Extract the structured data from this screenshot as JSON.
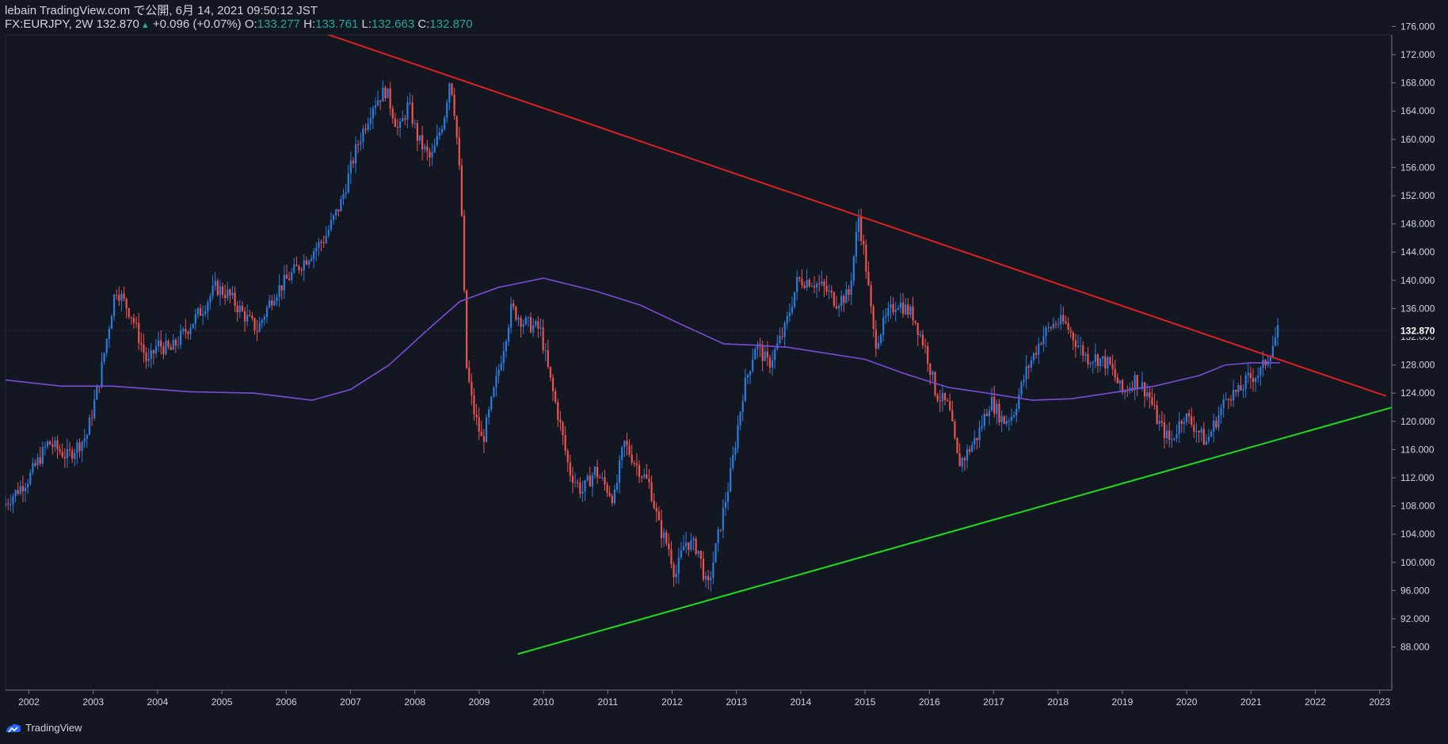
{
  "header": {
    "publish_line": "lebain TradingView.com で公開, 6月 14, 2021 09:50:12 JST",
    "symbol": "FX:EURJPY, 2W",
    "last": "132.870",
    "change_arrow": "▲",
    "change": "+0.096 (+0.07%)",
    "o_label": "O:",
    "o_value": "133.277",
    "h_label": "H:",
    "h_value": "133.761",
    "l_label": "L:",
    "l_value": "132.663",
    "c_label": "C:",
    "c_value": "132.870"
  },
  "footer": {
    "brand": "TradingView"
  },
  "colors": {
    "background": "#131722",
    "up_candle": "#2a7ddf",
    "down_candle": "#ef5350",
    "resistance_line": "#e21f1f",
    "support_line": "#1fdc1f",
    "moving_average": "#7b4bd8",
    "text": "#d1d4dc",
    "accent_green": "#26a69a"
  },
  "chart_data": {
    "type": "candlestick",
    "symbol": "FX:EURJPY",
    "interval": "2W",
    "ylim": [
      86,
      179
    ],
    "y_ticks": [
      "176.000",
      "172.000",
      "168.000",
      "164.000",
      "160.000",
      "156.000",
      "152.000",
      "148.000",
      "144.000",
      "140.000",
      "136.000",
      "132.000",
      "128.000",
      "124.000",
      "120.000",
      "116.000",
      "112.000",
      "108.000",
      "104.000",
      "100.000",
      "96.000",
      "92.000",
      "88.000"
    ],
    "x_ticks": [
      "2002",
      "2003",
      "2004",
      "2005",
      "2006",
      "2007",
      "2008",
      "2009",
      "2010",
      "2011",
      "2012",
      "2013",
      "2014",
      "2015",
      "2016",
      "2017",
      "2018",
      "2019",
      "2020",
      "2021",
      "2022",
      "2023"
    ],
    "last_price_label": "132.870",
    "price_path": [
      [
        2001.6,
        108
      ],
      [
        2002.0,
        112
      ],
      [
        2002.3,
        117
      ],
      [
        2002.6,
        115
      ],
      [
        2002.9,
        118
      ],
      [
        2003.1,
        126
      ],
      [
        2003.35,
        139
      ],
      [
        2003.6,
        135
      ],
      [
        2003.85,
        128
      ],
      [
        2004.0,
        131
      ],
      [
        2004.2,
        130
      ],
      [
        2004.45,
        133
      ],
      [
        2004.7,
        136
      ],
      [
        2004.9,
        139
      ],
      [
        2005.1,
        138
      ],
      [
        2005.35,
        135
      ],
      [
        2005.55,
        133
      ],
      [
        2005.8,
        138
      ],
      [
        2006.0,
        140
      ],
      [
        2006.3,
        143
      ],
      [
        2006.6,
        146
      ],
      [
        2006.85,
        151
      ],
      [
        2007.1,
        159
      ],
      [
        2007.35,
        165
      ],
      [
        2007.55,
        167
      ],
      [
        2007.75,
        161
      ],
      [
        2007.9,
        165
      ],
      [
        2008.05,
        160
      ],
      [
        2008.25,
        157
      ],
      [
        2008.45,
        163
      ],
      [
        2008.55,
        169
      ],
      [
        2008.63,
        163
      ],
      [
        2008.72,
        152
      ],
      [
        2008.8,
        128
      ],
      [
        2008.9,
        122
      ],
      [
        2009.05,
        117
      ],
      [
        2009.25,
        125
      ],
      [
        2009.5,
        136
      ],
      [
        2009.7,
        134
      ],
      [
        2009.95,
        133
      ],
      [
        2010.1,
        126
      ],
      [
        2010.25,
        120
      ],
      [
        2010.4,
        113
      ],
      [
        2010.6,
        110
      ],
      [
        2010.8,
        113
      ],
      [
        2010.95,
        111
      ],
      [
        2011.1,
        109
      ],
      [
        2011.25,
        117
      ],
      [
        2011.5,
        113
      ],
      [
        2011.65,
        111
      ],
      [
        2011.8,
        105
      ],
      [
        2011.95,
        102
      ],
      [
        2012.05,
        98
      ],
      [
        2012.2,
        103
      ],
      [
        2012.4,
        102
      ],
      [
        2012.55,
        96
      ],
      [
        2012.7,
        103
      ],
      [
        2012.9,
        112
      ],
      [
        2013.1,
        124
      ],
      [
        2013.3,
        131
      ],
      [
        2013.5,
        128
      ],
      [
        2013.75,
        133
      ],
      [
        2013.95,
        140
      ],
      [
        2014.15,
        140
      ],
      [
        2014.35,
        139
      ],
      [
        2014.55,
        137
      ],
      [
        2014.75,
        138
      ],
      [
        2014.9,
        149
      ],
      [
        2015.0,
        143
      ],
      [
        2015.15,
        131
      ],
      [
        2015.35,
        135
      ],
      [
        2015.5,
        137
      ],
      [
        2015.75,
        135
      ],
      [
        2015.95,
        130
      ],
      [
        2016.1,
        124
      ],
      [
        2016.3,
        122
      ],
      [
        2016.45,
        114
      ],
      [
        2016.55,
        115
      ],
      [
        2016.75,
        118
      ],
      [
        2016.95,
        123
      ],
      [
        2017.15,
        120
      ],
      [
        2017.3,
        121
      ],
      [
        2017.5,
        127
      ],
      [
        2017.75,
        132
      ],
      [
        2017.95,
        134
      ],
      [
        2018.1,
        134
      ],
      [
        2018.3,
        131
      ],
      [
        2018.45,
        129
      ],
      [
        2018.6,
        129
      ],
      [
        2018.8,
        128
      ],
      [
        2019.0,
        124
      ],
      [
        2019.2,
        126
      ],
      [
        2019.4,
        124
      ],
      [
        2019.55,
        120
      ],
      [
        2019.75,
        117
      ],
      [
        2019.95,
        121
      ],
      [
        2020.15,
        119
      ],
      [
        2020.3,
        117
      ],
      [
        2020.5,
        121
      ],
      [
        2020.65,
        124
      ],
      [
        2020.8,
        124
      ],
      [
        2020.95,
        126
      ],
      [
        2021.15,
        127
      ],
      [
        2021.3,
        130
      ],
      [
        2021.45,
        133.5
      ]
    ],
    "series": [
      {
        "name": "",
        "type": "moving_average",
        "points": [
          [
            2001.5,
            126
          ],
          [
            2002.5,
            125
          ],
          [
            2003.3,
            125
          ],
          [
            2004.5,
            124.2
          ],
          [
            2005.5,
            124
          ],
          [
            2006.4,
            123
          ],
          [
            2007.0,
            124.5
          ],
          [
            2007.6,
            128
          ],
          [
            2008.2,
            133
          ],
          [
            2008.7,
            137
          ],
          [
            2009.3,
            139
          ],
          [
            2010.0,
            140.3
          ],
          [
            2010.8,
            138.5
          ],
          [
            2011.5,
            136.5
          ],
          [
            2012.2,
            133.5
          ],
          [
            2012.8,
            131
          ],
          [
            2013.3,
            130.8
          ],
          [
            2013.8,
            130.5
          ],
          [
            2014.5,
            129.5
          ],
          [
            2015.0,
            128.8
          ],
          [
            2015.6,
            126.8
          ],
          [
            2016.3,
            124.8
          ],
          [
            2016.9,
            124
          ],
          [
            2017.6,
            123
          ],
          [
            2018.2,
            123.2
          ],
          [
            2018.8,
            124
          ],
          [
            2019.5,
            125
          ],
          [
            2020.2,
            126.5
          ],
          [
            2020.6,
            128
          ],
          [
            2021.0,
            128.3
          ],
          [
            2021.45,
            128.3
          ]
        ]
      },
      {
        "name": "",
        "type": "trendline",
        "color": "resistance",
        "points": [
          [
            2005.0,
            180
          ],
          [
            2023.1,
            123.6
          ]
        ]
      },
      {
        "name": "",
        "type": "trendline",
        "color": "support",
        "points": [
          [
            2009.6,
            87
          ],
          [
            2023.2,
            122.0
          ]
        ]
      }
    ]
  }
}
